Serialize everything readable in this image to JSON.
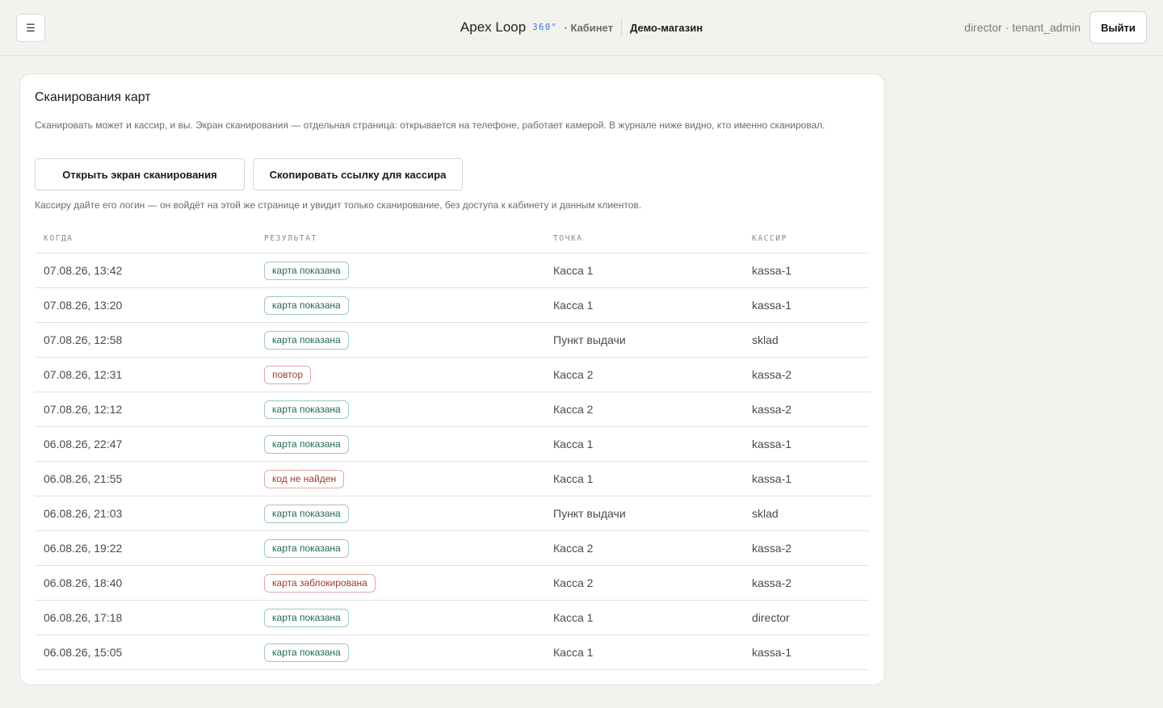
{
  "header": {
    "menu_icon": "☰",
    "brand_name": "Apex Loop",
    "brand_badge": "360°",
    "brand_section": "· Кабинет",
    "shop_name": "Демо-магазин",
    "user_info": "director · tenant_admin",
    "logout_label": "Выйти"
  },
  "card": {
    "title": "Сканирования карт",
    "description": "Сканировать может и кассир, и вы. Экран сканирования — отдельная страница: открывается на телефоне, работает камерой. В журнале ниже видно, кто именно сканировал.",
    "open_scan_label": "Открыть экран сканирования",
    "copy_link_label": "Скопировать ссылку для кассира",
    "hint": "Кассиру дайте его логин — он войдёт на этой же странице и увидит только сканирование, без доступа к кабинету и данным клиентов."
  },
  "table": {
    "columns": {
      "when": "КОГДА",
      "result": "РЕЗУЛЬТАТ",
      "point": "ТОЧКА",
      "cashier": "КАССИР"
    },
    "rows": [
      {
        "when": "07.08.26, 13:42",
        "result": "карта показана",
        "status": "ok",
        "point": "Касса 1",
        "cashier": "kassa-1"
      },
      {
        "when": "07.08.26, 13:20",
        "result": "карта показана",
        "status": "ok",
        "point": "Касса 1",
        "cashier": "kassa-1"
      },
      {
        "when": "07.08.26, 12:58",
        "result": "карта показана",
        "status": "ok",
        "point": "Пункт выдачи",
        "cashier": "sklad"
      },
      {
        "when": "07.08.26, 12:31",
        "result": "повтор",
        "status": "bad",
        "point": "Касса 2",
        "cashier": "kassa-2"
      },
      {
        "when": "07.08.26, 12:12",
        "result": "карта показана",
        "status": "ok",
        "point": "Касса 2",
        "cashier": "kassa-2"
      },
      {
        "when": "06.08.26, 22:47",
        "result": "карта показана",
        "status": "ok",
        "point": "Касса 1",
        "cashier": "kassa-1"
      },
      {
        "when": "06.08.26, 21:55",
        "result": "код не найден",
        "status": "bad",
        "point": "Касса 1",
        "cashier": "kassa-1"
      },
      {
        "when": "06.08.26, 21:03",
        "result": "карта показана",
        "status": "ok",
        "point": "Пункт выдачи",
        "cashier": "sklad"
      },
      {
        "when": "06.08.26, 19:22",
        "result": "карта показана",
        "status": "ok",
        "point": "Касса 2",
        "cashier": "kassa-2"
      },
      {
        "when": "06.08.26, 18:40",
        "result": "карта заблокирована",
        "status": "bad",
        "point": "Касса 2",
        "cashier": "kassa-2"
      },
      {
        "when": "06.08.26, 17:18",
        "result": "карта показана",
        "status": "ok",
        "point": "Касса 1",
        "cashier": "director"
      },
      {
        "when": "06.08.26, 15:05",
        "result": "карта показана",
        "status": "ok",
        "point": "Касса 1",
        "cashier": "kassa-1"
      }
    ]
  },
  "colors": {
    "ok": "#1f6b47",
    "bad": "#a03a2e",
    "accent": "#3b6fd8"
  }
}
